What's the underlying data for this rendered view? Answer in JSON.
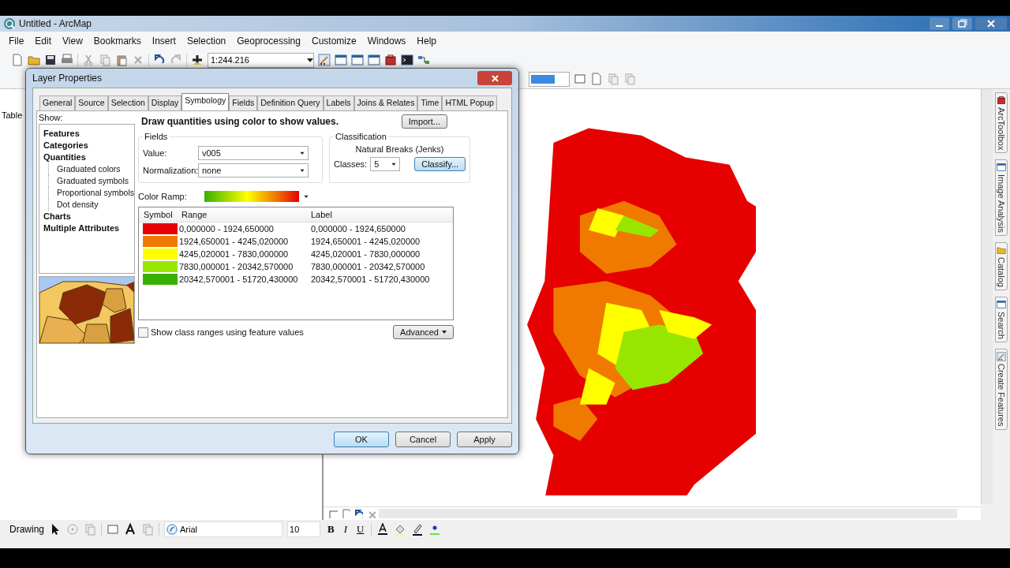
{
  "window": {
    "title": "Untitled - ArcMap"
  },
  "menu": [
    "File",
    "Edit",
    "View",
    "Bookmarks",
    "Insert",
    "Selection",
    "Geoprocessing",
    "Customize",
    "Windows",
    "Help"
  ],
  "toolbar": {
    "scale": "1:244.216"
  },
  "toc": {
    "tab": "Table"
  },
  "dock_tabs": [
    "ArcToolbox",
    "Image Analysis",
    "Catalog",
    "Search",
    "Create Features"
  ],
  "drawing_toolbar": {
    "menu": "Drawing",
    "font": "Arial",
    "size": "10",
    "bold": "B",
    "italic": "I",
    "underline": "U"
  },
  "dialog": {
    "title": "Layer Properties",
    "tabs": [
      {
        "label": "General",
        "selected": false
      },
      {
        "label": "Source",
        "selected": false
      },
      {
        "label": "Selection",
        "selected": false
      },
      {
        "label": "Display",
        "selected": false
      },
      {
        "label": "Symbology",
        "selected": true
      },
      {
        "label": "Fields",
        "selected": false
      },
      {
        "label": "Definition Query",
        "selected": false
      },
      {
        "label": "Labels",
        "selected": false
      },
      {
        "label": "Joins & Relates",
        "selected": false
      },
      {
        "label": "Time",
        "selected": false
      },
      {
        "label": "HTML Popup",
        "selected": false
      }
    ],
    "show_label": "Show:",
    "show_tree": [
      {
        "label": "Features"
      },
      {
        "label": "Categories"
      },
      {
        "label": "Quantities",
        "children": [
          {
            "label": "Graduated colors"
          },
          {
            "label": "Graduated symbols"
          },
          {
            "label": "Proportional symbols"
          },
          {
            "label": "Dot density"
          }
        ]
      },
      {
        "label": "Charts"
      },
      {
        "label": "Multiple Attributes"
      }
    ],
    "heading": "Draw quantities using color to show values.",
    "import_button": "Import...",
    "fields": {
      "legend": "Fields",
      "value_label": "Value:",
      "value": "v005",
      "normalization_label": "Normalization:",
      "normalization": "none"
    },
    "classification": {
      "legend": "Classification",
      "method": "Natural Breaks (Jenks)",
      "classes_label": "Classes:",
      "classes": "5",
      "classify_button": "Classify..."
    },
    "color_ramp_label": "Color Ramp:",
    "table": {
      "columns": [
        "Symbol",
        "Range",
        "Label"
      ],
      "rows": [
        {
          "color": "#e60000",
          "range": "0,000000 - 1924,650000",
          "label": "0,000000 - 1924,650000"
        },
        {
          "color": "#f07a00",
          "range": "1924,650001 - 4245,020000",
          "label": "1924,650001 - 4245,020000"
        },
        {
          "color": "#ffff00",
          "range": "4245,020001 - 7830,000000",
          "label": "4245,020001 - 7830,000000"
        },
        {
          "color": "#98e600",
          "range": "7830,000001 - 20342,570000",
          "label": "7830,000001 - 20342,570000"
        },
        {
          "color": "#38b000",
          "range": "20342,570001 - 51720,430000",
          "label": "20342,570001 - 51720,430000"
        }
      ]
    },
    "checkbox": {
      "label": "Show class ranges using feature values",
      "checked": false
    },
    "advanced_button": "Advanced",
    "buttons": [
      "OK",
      "Cancel",
      "Apply"
    ]
  }
}
